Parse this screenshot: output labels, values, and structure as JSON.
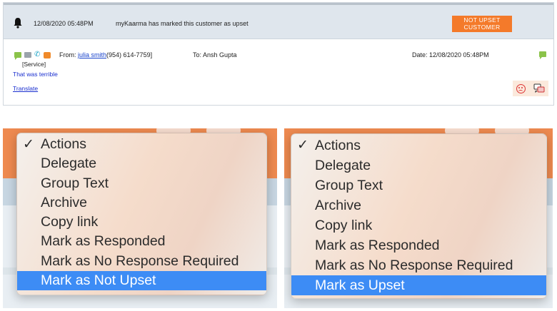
{
  "status_row": {
    "timestamp": "12/08/2020 05:48PM",
    "message": "myKaarma has marked this customer as upset",
    "badge_line1": "NOT UPSET",
    "badge_line2": "CUSTOMER",
    "icon": "bell-icon"
  },
  "message": {
    "from_prefix": "From:",
    "from_name": "julia smith",
    "from_phone": "(954) 614-7759]",
    "department": "[Service]",
    "body": "That was terrible",
    "translate_label": "Translate",
    "to_label": "To: Ansh Gupta",
    "date_label": "Date: 12/08/2020 05:48PM",
    "icons": [
      "chat-icon",
      "mail-icon",
      "phone-icon",
      "sms-icon"
    ]
  },
  "menu_left": {
    "items": [
      "Actions",
      "Delegate",
      "Group Text",
      "Archive",
      "Copy link",
      "Mark as Responded",
      "Mark as No Response Required",
      "Mark as Not Upset"
    ],
    "checked": "Actions",
    "highlighted": "Mark as Not Upset"
  },
  "menu_right": {
    "items": [
      "Actions",
      "Delegate",
      "Group Text",
      "Archive",
      "Copy link",
      "Mark as Responded",
      "Mark as No Response Required",
      "Mark as Upset"
    ],
    "checked": "Actions",
    "highlighted": "Mark as Upset"
  },
  "colors": {
    "accent_orange": "#f47a2a",
    "highlight_blue": "#3d8cf5",
    "link_blue": "#1a2fcf"
  }
}
